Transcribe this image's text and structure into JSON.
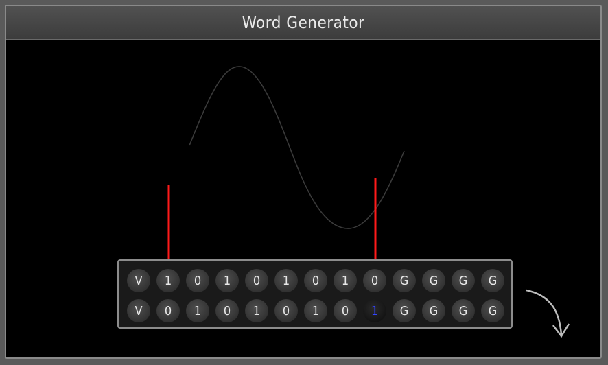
{
  "window": {
    "title": "Word Generator"
  },
  "rows": [
    {
      "pins": [
        "V",
        "1",
        "0",
        "1",
        "0",
        "1",
        "0",
        "1",
        "0",
        "G",
        "G",
        "G",
        "G"
      ],
      "highlight_index": -1
    },
    {
      "pins": [
        "V",
        "0",
        "1",
        "0",
        "1",
        "0",
        "1",
        "0",
        "1",
        "G",
        "G",
        "G",
        "G"
      ],
      "highlight_index": 8
    }
  ],
  "colors": {
    "arrow": "#ff1a1a",
    "highlight_text": "#3344ff",
    "wave": "#3a3a3a",
    "curved_arrow": "#bdbdbd"
  },
  "icons": {
    "rotate": "curved-arrow-icon"
  }
}
